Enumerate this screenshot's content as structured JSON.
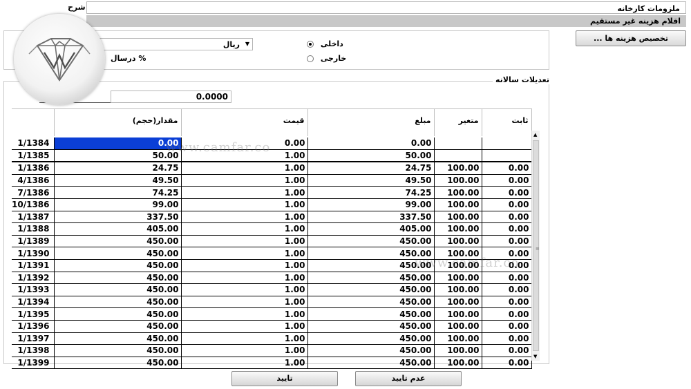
{
  "header": {
    "description_label": "شرح",
    "description_value": "ملزومات کارخانه",
    "category_bar": "اقلام هزینه غیر مستقیم"
  },
  "alloc_button": "... تخصیص هزینه ها",
  "unit": {
    "selected": "ریال"
  },
  "percent_label": "درسال %",
  "origin": {
    "domestic_label": "داخلی",
    "foreign_label": "خارجی",
    "selected": "domestic"
  },
  "annual": {
    "legend": "تعدیلات سالانه",
    "amount": "0.0000"
  },
  "table": {
    "columns": [
      "ثابت",
      "متغیر",
      "مبلغ",
      "قیمت",
      "مقدار(حجم)",
      ""
    ],
    "rows": [
      {
        "fixed": "",
        "variable": "",
        "amount": "0.00",
        "price": "0.00",
        "qty": "0.00",
        "period": "1/1384"
      },
      {
        "fixed": "",
        "variable": "",
        "amount": "50.00",
        "price": "1.00",
        "qty": "50.00",
        "period": "1/1385"
      },
      {
        "fixed": "0.00",
        "variable": "100.00",
        "amount": "24.75",
        "price": "1.00",
        "qty": "24.75",
        "period": "1/1386"
      },
      {
        "fixed": "0.00",
        "variable": "100.00",
        "amount": "49.50",
        "price": "1.00",
        "qty": "49.50",
        "period": "4/1386"
      },
      {
        "fixed": "0.00",
        "variable": "100.00",
        "amount": "74.25",
        "price": "1.00",
        "qty": "74.25",
        "period": "7/1386"
      },
      {
        "fixed": "0.00",
        "variable": "100.00",
        "amount": "99.00",
        "price": "1.00",
        "qty": "99.00",
        "period": "10/1386"
      },
      {
        "fixed": "0.00",
        "variable": "100.00",
        "amount": "337.50",
        "price": "1.00",
        "qty": "337.50",
        "period": "1/1387"
      },
      {
        "fixed": "0.00",
        "variable": "100.00",
        "amount": "405.00",
        "price": "1.00",
        "qty": "405.00",
        "period": "1/1388"
      },
      {
        "fixed": "0.00",
        "variable": "100.00",
        "amount": "450.00",
        "price": "1.00",
        "qty": "450.00",
        "period": "1/1389"
      },
      {
        "fixed": "0.00",
        "variable": "100.00",
        "amount": "450.00",
        "price": "1.00",
        "qty": "450.00",
        "period": "1/1390"
      },
      {
        "fixed": "0.00",
        "variable": "100.00",
        "amount": "450.00",
        "price": "1.00",
        "qty": "450.00",
        "period": "1/1391"
      },
      {
        "fixed": "0.00",
        "variable": "100.00",
        "amount": "450.00",
        "price": "1.00",
        "qty": "450.00",
        "period": "1/1392"
      },
      {
        "fixed": "0.00",
        "variable": "100.00",
        "amount": "450.00",
        "price": "1.00",
        "qty": "450.00",
        "period": "1/1393"
      },
      {
        "fixed": "0.00",
        "variable": "100.00",
        "amount": "450.00",
        "price": "1.00",
        "qty": "450.00",
        "period": "1/1394"
      },
      {
        "fixed": "0.00",
        "variable": "100.00",
        "amount": "450.00",
        "price": "1.00",
        "qty": "450.00",
        "period": "1/1395"
      },
      {
        "fixed": "0.00",
        "variable": "100.00",
        "amount": "450.00",
        "price": "1.00",
        "qty": "450.00",
        "period": "1/1396"
      },
      {
        "fixed": "0.00",
        "variable": "100.00",
        "amount": "450.00",
        "price": "1.00",
        "qty": "450.00",
        "period": "1/1397"
      },
      {
        "fixed": "0.00",
        "variable": "100.00",
        "amount": "450.00",
        "price": "1.00",
        "qty": "450.00",
        "period": "1/1398"
      },
      {
        "fixed": "0.00",
        "variable": "100.00",
        "amount": "450.00",
        "price": "1.00",
        "qty": "450.00",
        "period": "1/1399"
      }
    ]
  },
  "buttons": {
    "confirm": "تایید",
    "reject": "عدم تایید"
  },
  "watermark": {
    "text1": "www.camfar.co",
    "text2": "www.camfar.co"
  },
  "colors": {
    "selection": "#0b3fd6",
    "category_bar": "#c8c8c8"
  },
  "icons": {
    "logo": "diamond-logo-icon",
    "dropdown": "chevron-down-icon"
  }
}
